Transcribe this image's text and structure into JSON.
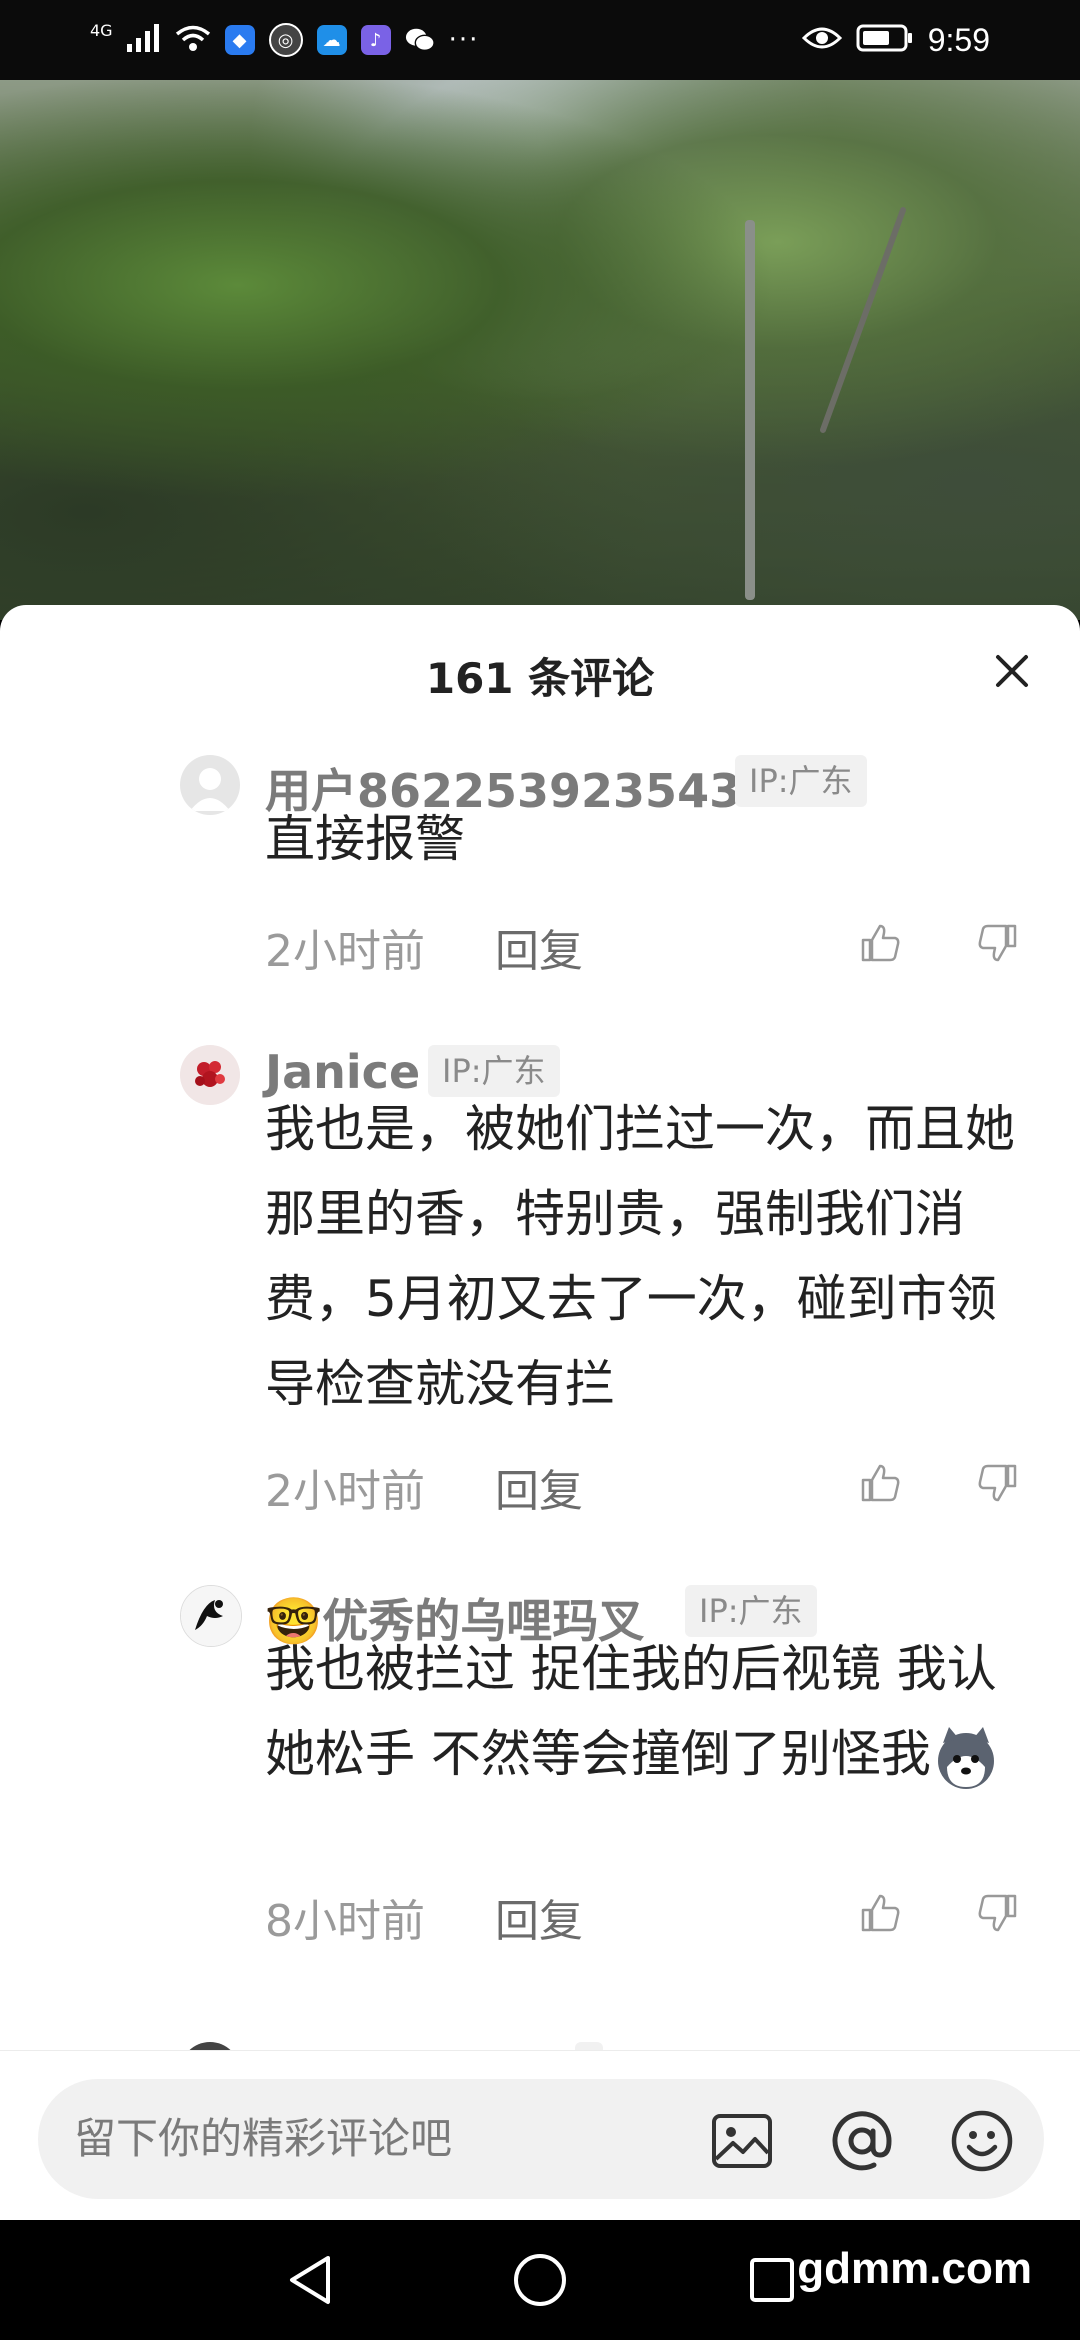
{
  "status_bar": {
    "network": "4G",
    "time": "9:59",
    "icons": [
      "signal-icon",
      "wifi-icon",
      "shield-app-icon",
      "globe-app-icon",
      "cloud-app-icon",
      "music-app-icon",
      "wechat-app-icon",
      "more-notifications-icon",
      "eye-comfort-icon",
      "battery-icon"
    ]
  },
  "sheet": {
    "title": "161 条评论",
    "close_icon": "close-icon"
  },
  "comments": [
    {
      "author": "用户862253923543",
      "ip": "IP:广东",
      "text": "直接报警",
      "time": "2小时前",
      "reply": "回复",
      "avatar": "default-avatar-icon"
    },
    {
      "author": "Janice",
      "ip": "IP:广东",
      "text": "我也是，被她们拦过一次，而且她那里的香，特别贵，强制我们消费，5月初又去了一次，碰到市领导检查就没有拦",
      "time": "2小时前",
      "reply": "回复",
      "avatar": "flower-avatar-icon"
    },
    {
      "author_emoji": "🤓",
      "author": "优秀的乌哩玛叉",
      "ip": "IP:广东",
      "text": "我也被拦过 捉住我的后视镜 我认她松手 不然等会撞倒了别怪我",
      "time": "8小时前",
      "reply": "回复",
      "avatar": "ink-figure-avatar-icon"
    }
  ],
  "input_bar": {
    "placeholder": "留下你的精彩评论吧",
    "icons": [
      "image-icon",
      "at-sign-icon",
      "smiley-icon"
    ]
  },
  "navigation": {
    "icons": [
      "back-triangle-icon",
      "home-circle-icon",
      "recents-square-icon"
    ]
  },
  "watermark": "gdmm.com"
}
